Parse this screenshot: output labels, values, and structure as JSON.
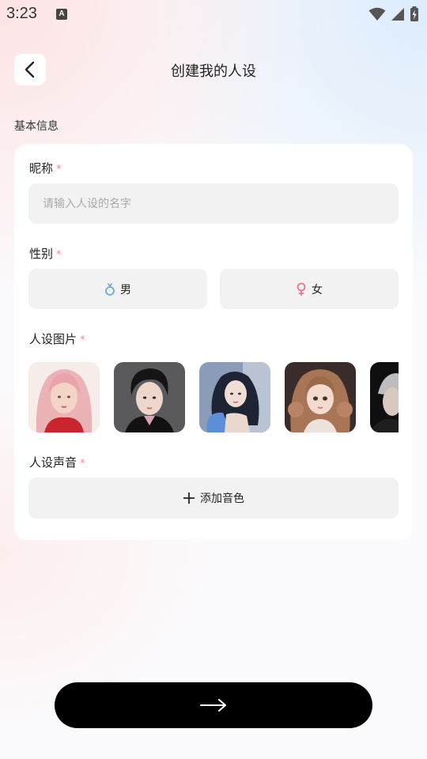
{
  "status_bar": {
    "time": "3:23",
    "notification_badge": "A",
    "icons": [
      "wifi-icon",
      "signal-icon",
      "battery-charging-icon"
    ]
  },
  "header": {
    "back_icon": "chevron-left-icon",
    "title": "创建我的人设"
  },
  "section": {
    "title": "基本信息"
  },
  "form": {
    "nickname": {
      "label": "昵称",
      "required_mark": "*",
      "value": "",
      "placeholder": "请输入人设的名字"
    },
    "gender": {
      "label": "性别",
      "required_mark": "*",
      "options": [
        {
          "label": "男",
          "icon": "male-symbol-icon",
          "color": "#6aa9e0"
        },
        {
          "label": "女",
          "icon": "female-symbol-icon",
          "color": "#f0748f"
        }
      ]
    },
    "images": {
      "label": "人设图片",
      "required_mark": "*",
      "items": [
        {
          "icon": "avatar-pink-hair-girl"
        },
        {
          "icon": "avatar-dark-hair-boy"
        },
        {
          "icon": "avatar-blue-dress-girl"
        },
        {
          "icon": "avatar-curly-hair-girl"
        },
        {
          "icon": "avatar-dark-portrait"
        }
      ]
    },
    "voice": {
      "label": "人设声音",
      "required_mark": "*",
      "add_label": "添加音色",
      "add_icon": "plus-icon"
    }
  },
  "next_button": {
    "icon": "arrow-right-icon"
  },
  "colors": {
    "required": "#f08aa3",
    "field_bg": "#f2f2f2",
    "primary_button": "#000000"
  }
}
